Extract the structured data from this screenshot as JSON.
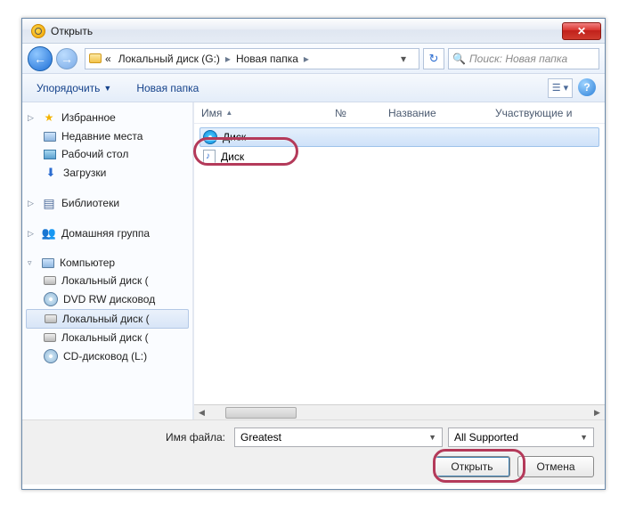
{
  "window": {
    "title": "Открыть"
  },
  "nav": {
    "breadcrumb_prefix": "«",
    "segments": [
      "Локальный диск (G:)",
      "Новая папка"
    ],
    "search_placeholder": "Поиск: Новая папка"
  },
  "toolbar": {
    "organize": "Упорядочить",
    "new_folder": "Новая папка"
  },
  "sidebar": {
    "favorites": {
      "label": "Избранное",
      "items": [
        "Недавние места",
        "Рабочий стол",
        "Загрузки"
      ]
    },
    "libraries": {
      "label": "Библиотеки"
    },
    "homegroup": {
      "label": "Домашняя группа"
    },
    "computer": {
      "label": "Компьютер",
      "items": [
        "Локальный диск (",
        "DVD RW дисковод",
        "Локальный диск (",
        "Локальный диск (",
        "CD-дисковод (L:)"
      ],
      "selected_index": 2
    }
  },
  "columns": {
    "name": "Имя",
    "num": "№",
    "title": "Название",
    "artists": "Участвующие и"
  },
  "files": [
    {
      "name": "Диск",
      "type": "cue",
      "selected": true
    },
    {
      "name": "Диск",
      "type": "audio",
      "selected": false
    }
  ],
  "footer": {
    "filename_label": "Имя файла:",
    "filename_value": "Greatest",
    "filter": "All Supported",
    "open": "Открыть",
    "cancel": "Отмена"
  }
}
